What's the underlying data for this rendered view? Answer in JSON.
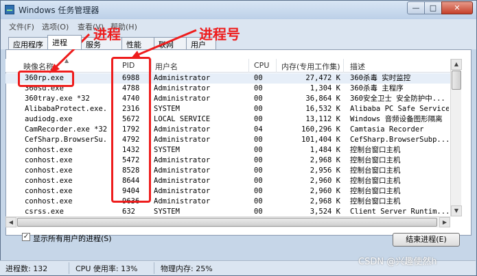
{
  "window": {
    "title": "Windows 任务管理器",
    "controls": {
      "minimize": "—",
      "maximize": "□",
      "close": "✕"
    }
  },
  "menu": [
    "文件(F)",
    "选项(O)",
    "查看(V)",
    "帮助(H)"
  ],
  "tabs": [
    {
      "label": "应用程序",
      "active": false
    },
    {
      "label": "进程",
      "active": true
    },
    {
      "label": "服务",
      "active": false
    },
    {
      "label": "性能",
      "active": false
    },
    {
      "label": "联网",
      "active": false
    },
    {
      "label": "用户",
      "active": false
    }
  ],
  "columns": {
    "image": "映像名称",
    "pid": "PID",
    "user": "用户名",
    "cpu": "CPU",
    "memory": "内存(专用工作集)",
    "desc": "描述"
  },
  "rows": [
    {
      "image": "360rp.exe",
      "pid": "6988",
      "user": "Administrator",
      "cpu": "00",
      "memory": "27,472 K",
      "desc": "360杀毒 实时监控"
    },
    {
      "image": "360sd.exe",
      "pid": "4788",
      "user": "Administrator",
      "cpu": "00",
      "memory": "1,304 K",
      "desc": "360杀毒 主程序"
    },
    {
      "image": "360tray.exe *32",
      "pid": "4740",
      "user": "Administrator",
      "cpu": "00",
      "memory": "36,864 K",
      "desc": "360安全卫士 安全防护中..."
    },
    {
      "image": "AlibabaProtect.exe...",
      "pid": "2316",
      "user": "SYSTEM",
      "cpu": "00",
      "memory": "16,532 K",
      "desc": "Alibaba PC Safe Service"
    },
    {
      "image": "audiodg.exe",
      "pid": "5672",
      "user": "LOCAL SERVICE",
      "cpu": "00",
      "memory": "13,112 K",
      "desc": "Windows 音频设备图形隔离"
    },
    {
      "image": "CamRecorder.exe *32",
      "pid": "1792",
      "user": "Administrator",
      "cpu": "04",
      "memory": "160,296 K",
      "desc": "Camtasia Recorder"
    },
    {
      "image": "CefSharp.BrowserSu...",
      "pid": "4792",
      "user": "Administrator",
      "cpu": "00",
      "memory": "101,404 K",
      "desc": "CefSharp.BrowserSubp..."
    },
    {
      "image": "conhost.exe",
      "pid": "1432",
      "user": "SYSTEM",
      "cpu": "00",
      "memory": "1,484 K",
      "desc": "控制台窗口主机"
    },
    {
      "image": "conhost.exe",
      "pid": "5472",
      "user": "Administrator",
      "cpu": "00",
      "memory": "2,968 K",
      "desc": "控制台窗口主机"
    },
    {
      "image": "conhost.exe",
      "pid": "8528",
      "user": "Administrator",
      "cpu": "00",
      "memory": "2,956 K",
      "desc": "控制台窗口主机"
    },
    {
      "image": "conhost.exe",
      "pid": "8644",
      "user": "Administrator",
      "cpu": "00",
      "memory": "2,960 K",
      "desc": "控制台窗口主机"
    },
    {
      "image": "conhost.exe",
      "pid": "9404",
      "user": "Administrator",
      "cpu": "00",
      "memory": "2,960 K",
      "desc": "控制台窗口主机"
    },
    {
      "image": "conhost.exe",
      "pid": "9636",
      "user": "Administrator",
      "cpu": "00",
      "memory": "2,968 K",
      "desc": "控制台窗口主机"
    },
    {
      "image": "csrss.exe",
      "pid": "632",
      "user": "SYSTEM",
      "cpu": "00",
      "memory": "3,524 K",
      "desc": "Client Server Runtim..."
    }
  ],
  "show_all_users": {
    "label": "显示所有用户的进程(S)",
    "checked": true
  },
  "end_process_button": "结束进程(E)",
  "status": {
    "process_count": "进程数: 132",
    "cpu_usage": "CPU 使用率: 13%",
    "physical_memory": "物理内存: 25%"
  },
  "annotations": {
    "process_label": "进程",
    "pid_label": "进程号",
    "color": "#ee1c1c"
  },
  "watermark": "CSDN @兴趣使然h"
}
